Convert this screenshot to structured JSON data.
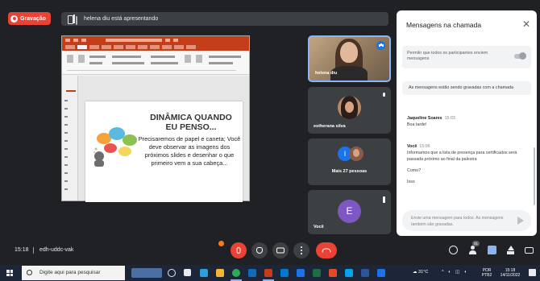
{
  "recording": {
    "label": "Gravação"
  },
  "presenting_banner": {
    "text": "helena diu está apresentando"
  },
  "slide": {
    "title": "DINÂMICA QUANDO EU PENSO...",
    "body": "Precisaremos de papel e caneta; Você deve observar as imagens dos próximos slides e desenhar o que primeiro vem a sua cabeça..."
  },
  "tiles": [
    {
      "name": "helena diu",
      "speaking": true
    },
    {
      "name": "estherana silva"
    },
    {
      "name": "Mais 27 pessoas",
      "avatar_letter": "I"
    },
    {
      "name": "Você",
      "avatar_letter": "E"
    }
  ],
  "chat": {
    "title": "Mensagens na chamada",
    "close_icon": "close-icon",
    "toggle_label": "Permitir que todos os participantes enviem mensagens",
    "recording_note": "As mensagens estão sendo gravadas com a chamada",
    "messages": [
      {
        "sender": "Jaqueline Soares",
        "time": "15:03",
        "lines": [
          "Boa tarde!"
        ]
      },
      {
        "sender": "Você",
        "time": "15:06",
        "lines": [
          "Informamos que a lista de presença para certificados será passada próximo ao final da palestra",
          "Como?",
          "Isso"
        ]
      }
    ],
    "input_placeholder": "Envie uma mensagem para todos. As mensagens também são gravadas."
  },
  "meeting_bar": {
    "time": "15:18",
    "meeting_code": "edh-uddc-vak",
    "participant_count": "31",
    "controls": [
      "mic",
      "camera",
      "raise-hand",
      "present",
      "more",
      "end-call"
    ],
    "end_call_color": "#ea4335"
  },
  "taskbar": {
    "search_placeholder": "Digite aqui para pesquisar",
    "weather": "31°C",
    "language": "POR PTB2",
    "clock_time": "15:18",
    "clock_date": "14/11/2022"
  },
  "colors": {
    "accent": "#1a73e8",
    "record_red": "#ea4335",
    "ppt_orange": "#c43e1c",
    "background": "#202124"
  }
}
